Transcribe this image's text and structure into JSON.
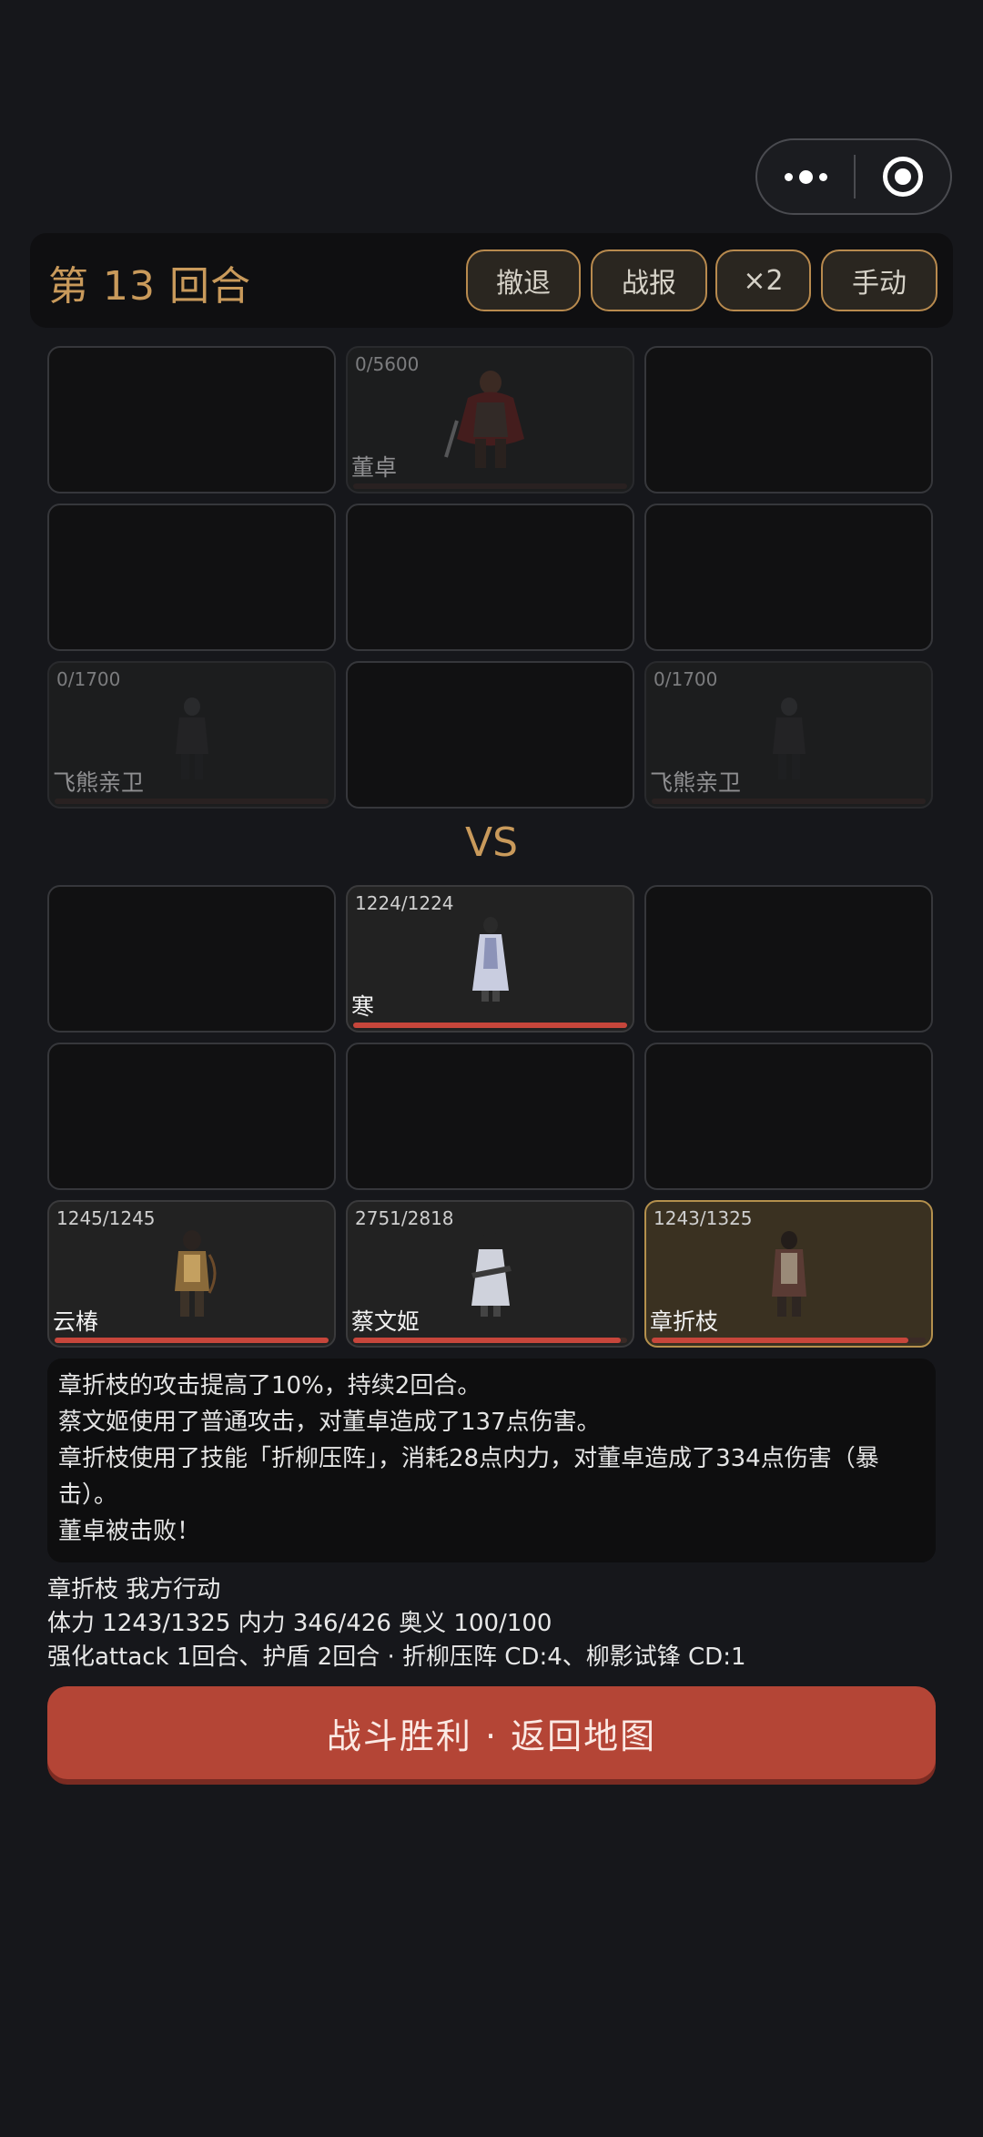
{
  "header": {
    "round_label": "第 13 回合",
    "buttons": {
      "retreat": "撤退",
      "report": "战报",
      "speed": "×2",
      "mode": "手动"
    }
  },
  "enemy": {
    "r1c2": {
      "hp": "0/5600",
      "name": "董卓",
      "hp_fraction": 0
    },
    "r3c1": {
      "hp": "0/1700",
      "name": "飞熊亲卫",
      "hp_fraction": 0
    },
    "r3c3": {
      "hp": "0/1700",
      "name": "飞熊亲卫",
      "hp_fraction": 0
    }
  },
  "vs_label": "VS",
  "ally": {
    "r1c2": {
      "hp": "1224/1224",
      "name": "寒",
      "hp_fraction": 1.0
    },
    "r3c1": {
      "hp": "1245/1245",
      "name": "云椿",
      "hp_fraction": 1.0
    },
    "r3c2": {
      "hp": "2751/2818",
      "name": "蔡文姬",
      "hp_fraction": 0.976
    },
    "r3c3": {
      "hp": "1243/1325",
      "name": "章折枝",
      "hp_fraction": 0.938
    }
  },
  "log": [
    "章折枝的攻击提高了10%，持续2回合。",
    "蔡文姬使用了普通攻击，对董卓造成了137点伤害。",
    "章折枝使用了技能「折柳压阵」，消耗28点内力，对董卓造成了334点伤害（暴击）。",
    "董卓被击败！"
  ],
  "status": {
    "line1": "章折枝  我方行动",
    "line2": "体力 1243/1325  内力 346/426  奥义 100/100",
    "line3": "强化attack 1回合、护盾 2回合 · 折柳压阵 CD:4、柳影试锋 CD:1"
  },
  "victory_button": "战斗胜利 · 返回地图",
  "colors": {
    "accent_gold": "#c99a5b",
    "hp_bar": "#c7463b",
    "victory": "#b44536"
  }
}
